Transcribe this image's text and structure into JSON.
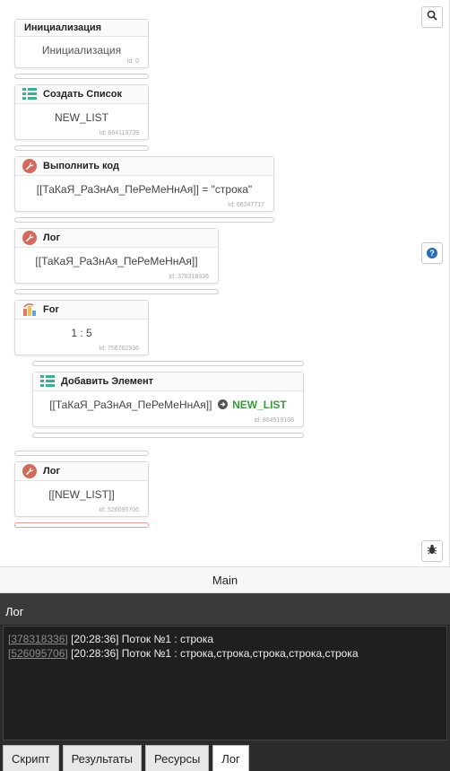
{
  "blocks": [
    {
      "title": "Инициализация",
      "body": "Инициализация",
      "id_label": "Id: 0"
    },
    {
      "title": "Создать Список",
      "body": "NEW_LIST",
      "id_label": "Id: 664113739"
    },
    {
      "title": "Выполнить код",
      "body": "[[ТаКаЯ_РаЗнАя_ПеРеМеНнАя]] = \"строка\"",
      "id_label": "Id: 66247717"
    },
    {
      "title": "Лог",
      "body": "[[ТаКаЯ_РаЗнАя_ПеРеМеНнАя]]",
      "id_label": "Id: 378318336"
    },
    {
      "title": "For",
      "body": "1 : 5",
      "id_label": "Id: 756762936"
    },
    {
      "title": "Добавить Элемент",
      "body_var": "[[ТаКаЯ_РаЗнАя_ПеРеМеНнАя]]",
      "body_target": "NEW_LIST",
      "id_label": "Id: 884519108"
    },
    {
      "title": "Лог",
      "body": "[[NEW_LIST]]",
      "id_label": "Id: 526095706"
    }
  ],
  "side_buttons": {
    "search_icon": "search-icon",
    "help_icon": "question-icon",
    "debug_icon": "bug-icon"
  },
  "main_label": "Main",
  "log_panel": {
    "title": "Лог",
    "lines": [
      {
        "id": "[378318336]",
        "text": "[20:28:36] Поток №1 : строка"
      },
      {
        "id": "[526095706]",
        "text": "[20:28:36] Поток №1 : строка,строка,строка,строка,строка"
      }
    ]
  },
  "tabs": [
    "Скрипт",
    "Результаты",
    "Ресурсы",
    "Лог"
  ],
  "active_tab": "Лог",
  "colors": {
    "accent_green": "#3a9a3a",
    "wrench_red": "#d26a5c",
    "list_green": "#3eb08f",
    "log_bg": "#1f1f1f"
  }
}
